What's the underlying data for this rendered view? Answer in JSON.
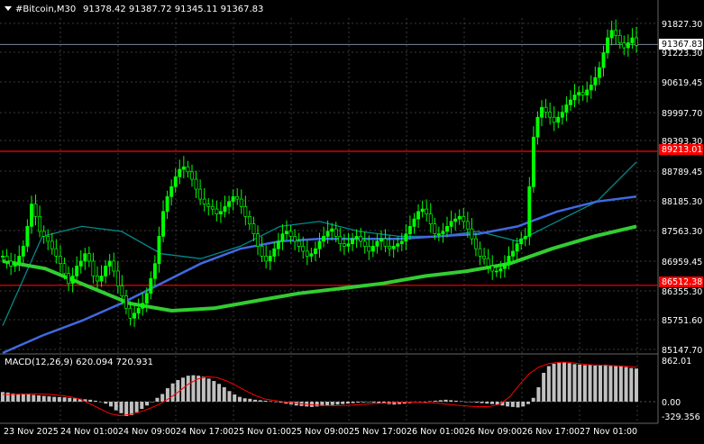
{
  "header": {
    "symbol_text": "#Bitcoin,M30",
    "ohlc_text": "91378.42 91387.72 91345.11 91367.83",
    "menu_icon": "triangle-down-icon"
  },
  "price_axis": {
    "labels": [
      "91827.30",
      "91223.30",
      "90619.45",
      "89997.70",
      "89393.30",
      "88789.45",
      "88185.30",
      "87563.30",
      "86959.45",
      "86355.30",
      "85751.60",
      "85147.70"
    ],
    "current_price": "91367.83",
    "level_high": "89213.01",
    "level_low": "86512.38"
  },
  "macd_panel": {
    "label": "MACD(12,26,9) 620.094 720.931",
    "axis_labels": [
      "862.01",
      "0.00",
      "-329.356"
    ]
  },
  "time_axis": {
    "labels": [
      "23 Nov 2025",
      "24 Nov 01:00",
      "24 Nov 09:00",
      "24 Nov 17:00",
      "25 Nov 01:00",
      "25 Nov 09:00",
      "25 Nov 17:00",
      "26 Nov 01:00",
      "26 Nov 09:00",
      "26 Nov 17:00",
      "27 Nov 01:00"
    ]
  },
  "colors": {
    "background": "#000000",
    "bull_candle": "#00ff00",
    "bear_candle": "#00ff00",
    "ma_fast": "#008b8b",
    "ma_mid": "#4169e1",
    "ma_slow": "#32cd32",
    "level_line": "#ff0000",
    "macd_hist": "#c0c0c0",
    "macd_signal": "#ff0000",
    "current_price_line": "#778899"
  },
  "chart_data": {
    "type": "candlestick",
    "symbol": "#Bitcoin",
    "timeframe": "M30",
    "ylim": [
      85147.7,
      91900
    ],
    "horizontal_levels": [
      89213.01,
      86512.38
    ],
    "current_price": 91367.83,
    "series": [
      {
        "name": "Price close (approx.)",
        "values": [
          87100,
          87000,
          86900,
          86950,
          87100,
          87300,
          87700,
          88150,
          87900,
          87600,
          87500,
          87400,
          87250,
          87100,
          86950,
          86750,
          86550,
          86700,
          86900,
          87000,
          87150,
          87000,
          86700,
          86600,
          86700,
          86900,
          87000,
          86800,
          86500,
          86300,
          86050,
          85850,
          85950,
          86050,
          86150,
          86350,
          86650,
          86950,
          87500,
          88000,
          88300,
          88500,
          88700,
          88850,
          88900,
          88800,
          88650,
          88450,
          88250,
          88150,
          88100,
          88050,
          87950,
          88000,
          88100,
          88200,
          88300,
          88250,
          88100,
          87900,
          87750,
          87550,
          87300,
          87100,
          87000,
          87100,
          87250,
          87400,
          87550,
          87600,
          87500,
          87400,
          87300,
          87200,
          87100,
          87150,
          87250,
          87400,
          87500,
          87600,
          87650,
          87500,
          87350,
          87300,
          87350,
          87450,
          87500,
          87400,
          87300,
          87200,
          87300,
          87400,
          87450,
          87300,
          87250,
          87300,
          87350,
          87400,
          87550,
          87700,
          87850,
          88000,
          88050,
          87950,
          87750,
          87550,
          87550,
          87600,
          87700,
          87800,
          87850,
          87900,
          87800,
          87650,
          87450,
          87250,
          87100,
          87050,
          86900,
          86800,
          86800,
          86850,
          86950,
          87100,
          87200,
          87350,
          87450,
          87500,
          88500,
          89500,
          89900,
          90100,
          90000,
          89900,
          89800,
          89900,
          90000,
          90150,
          90250,
          90350,
          90400,
          90350,
          90450,
          90550,
          90700,
          90900,
          91200,
          91500,
          91650,
          91550,
          91400,
          91300,
          91400,
          91500,
          91350
        ]
      },
      {
        "name": "MA fast (approx.)",
        "values": [
          85700,
          87500,
          87700,
          87600,
          87150,
          87050,
          87300,
          87700,
          87800,
          87600,
          87500,
          87500,
          87600,
          87400,
          87800,
          88200,
          89000
        ]
      },
      {
        "name": "MA mid (approx.)",
        "values": [
          85150,
          85500,
          85800,
          86150,
          86550,
          86950,
          87250,
          87400,
          87450,
          87450,
          87450,
          87500,
          87550,
          87700,
          88000,
          88200,
          88300
        ]
      },
      {
        "name": "MA slow (approx.)",
        "values": [
          87000,
          86850,
          86500,
          86150,
          86000,
          86050,
          86200,
          86350,
          86450,
          86550,
          86700,
          86800,
          86950,
          87250,
          87500,
          87700
        ]
      },
      {
        "name": "MACD histogram (approx.)",
        "values": [
          200,
          190,
          170,
          160,
          150,
          150,
          140,
          130,
          120,
          110,
          100,
          95,
          90,
          80,
          70,
          60,
          50,
          40,
          20,
          0,
          -40,
          -100,
          -180,
          -240,
          -300,
          -280,
          -220,
          -150,
          -80,
          0,
          80,
          160,
          280,
          380,
          450,
          500,
          540,
          550,
          540,
          520,
          480,
          430,
          370,
          300,
          220,
          150,
          100,
          70,
          60,
          40,
          30,
          20,
          10,
          0,
          -20,
          -40,
          -60,
          -80,
          -90,
          -100,
          -110,
          -100,
          -90,
          -80,
          -70,
          -60,
          -50,
          -40,
          -30,
          -20,
          -15,
          -10,
          -20,
          -30,
          -40,
          -50,
          -60,
          -50,
          -40,
          -30,
          -20,
          -10,
          0,
          10,
          20,
          30,
          40,
          30,
          20,
          10,
          0,
          -10,
          -20,
          -30,
          -40,
          -50,
          -60,
          -80,
          -100,
          -110,
          -120,
          -100,
          -50,
          80,
          300,
          600,
          740,
          790,
          810,
          820,
          800,
          780,
          770,
          760,
          760,
          750,
          760,
          770,
          760,
          750,
          740,
          720,
          700,
          690
        ]
      },
      {
        "name": "MACD signal (approx.)",
        "values": [
          150,
          150,
          160,
          165,
          160,
          150,
          130,
          100,
          50,
          -50,
          -150,
          -250,
          -290,
          -270,
          -220,
          -150,
          -60,
          60,
          200,
          360,
          470,
          520,
          500,
          430,
          330,
          220,
          120,
          50,
          20,
          -10,
          -30,
          -50,
          -70,
          -80,
          -85,
          -80,
          -70,
          -55,
          -40,
          -30,
          -20,
          -10,
          -10,
          -15,
          -25,
          -40,
          -60,
          -80,
          -95,
          -105,
          -100,
          -50,
          100,
          350,
          580,
          720,
          790,
          820,
          820,
          790,
          770,
          760,
          755,
          745,
          735,
          720
        ]
      }
    ]
  }
}
